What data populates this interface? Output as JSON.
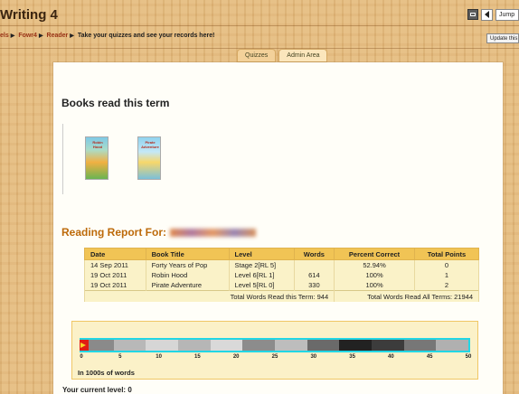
{
  "window": {
    "title": "Writing 4",
    "jump_label": "Jump"
  },
  "breadcrumb": {
    "items": [
      "els",
      "Fowr4",
      "Reader"
    ],
    "current": "Take your quizzes and see your records here!",
    "update_label": "Update this"
  },
  "tabs": [
    {
      "label": "Quizzes"
    },
    {
      "label": "Admin Area"
    }
  ],
  "books": {
    "heading": "Books read this term",
    "covers": [
      {
        "title": "Robin Hood"
      },
      {
        "title": "Pirate Adventure"
      }
    ]
  },
  "report": {
    "heading": "Reading Report For:",
    "columns": [
      "Date",
      "Book Title",
      "Level",
      "Words",
      "Percent Correct",
      "Total Points"
    ],
    "rows": [
      [
        "14 Sep 2011",
        "Forty Years of Pop",
        "Stage 2[RL 5]",
        "",
        "52.94%",
        "0"
      ],
      [
        "19 Oct 2011",
        "Robin Hood",
        "Level 6[RL 1]",
        "614",
        "100%",
        "1"
      ],
      [
        "19 Oct 2011",
        "Pirate Adventure",
        "Level 5[RL 0]",
        "330",
        "100%",
        "2"
      ]
    ],
    "total_term": "Total Words Read this Term: 944",
    "total_all": "Total Words Read All Terms: 21944"
  },
  "progress": {
    "ticks": [
      "0",
      "5",
      "10",
      "15",
      "20",
      "25",
      "30",
      "35",
      "40",
      "45",
      "50"
    ],
    "units_label": "In 1000s of words",
    "colors": [
      "#8a8a8a",
      "#8a8a8a",
      "#b8b8b8",
      "#b8b8b8",
      "#d6d6d6",
      "#d6d6d6",
      "#b6b6b6",
      "#b6b6b6",
      "#d9d9d9",
      "#d9d9d9",
      "#8c8c8c",
      "#8c8c8c",
      "#bdbdbd",
      "#bdbdbd",
      "#6a6a6a",
      "#6a6a6a",
      "#222222",
      "#222222",
      "#3c3c3c",
      "#3c3c3c",
      "#777777",
      "#777777",
      "#b0b0b0",
      "#b0b0b0"
    ]
  },
  "current_level": "Your current level: 0"
}
